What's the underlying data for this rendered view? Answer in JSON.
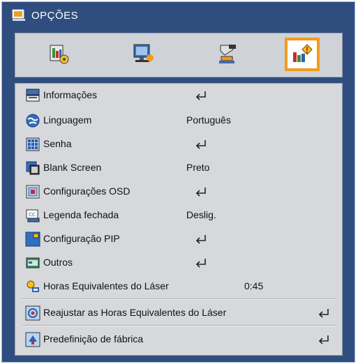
{
  "window": {
    "title": "OPÇÕES"
  },
  "tabs": [
    {
      "icon": "picture-settings-icon",
      "selected": false
    },
    {
      "icon": "screen-settings-icon",
      "selected": false
    },
    {
      "icon": "setup-icon",
      "selected": false
    },
    {
      "icon": "options-icon",
      "selected": true
    }
  ],
  "menu": {
    "items": [
      {
        "label": "Informações",
        "icon": "info-icon",
        "value": "",
        "enter": true
      },
      {
        "label": "Linguagem",
        "icon": "globe-icon",
        "value": "Português",
        "enter": false
      },
      {
        "label": "Senha",
        "icon": "keypad-icon",
        "value": "",
        "enter": true
      },
      {
        "label": "Blank Screen",
        "icon": "blank-screen-icon",
        "value": "Preto",
        "enter": false
      },
      {
        "label": "Configurações OSD",
        "icon": "osd-icon",
        "value": "",
        "enter": true
      },
      {
        "label": "Legenda fechada",
        "icon": "closed-caption-icon",
        "value": "Deslig.",
        "enter": false
      },
      {
        "label": "Configuração PIP",
        "icon": "pip-icon",
        "value": "",
        "enter": true
      },
      {
        "label": "Outros",
        "icon": "others-icon",
        "value": "",
        "enter": true
      },
      {
        "label": "Horas Equivalentes do Láser",
        "icon": "laser-hours-icon",
        "value": "0:45",
        "enter": false
      },
      {
        "label": "Reajustar as Horas Equivalentes do Láser",
        "icon": "reset-hours-icon",
        "value": "",
        "enter": true
      },
      {
        "label": "Predefinição de fábrica",
        "icon": "factory-reset-icon",
        "value": "",
        "enter": true
      }
    ]
  },
  "colors": {
    "frame": "#2f4e7f",
    "panel": "#d6d8db",
    "selected_border": "#f29a1e"
  }
}
